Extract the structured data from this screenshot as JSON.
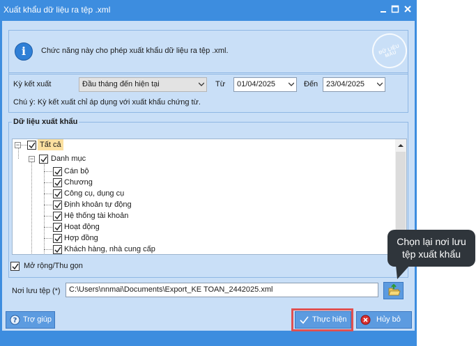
{
  "window": {
    "title": "Xuất khẩu dữ liệu ra tệp .xml",
    "accent_color": "#3d8ddf",
    "controls": [
      "minimize-icon",
      "maximize-icon",
      "close-icon"
    ]
  },
  "info": {
    "text": "Chức năng này cho phép xuất khẩu dữ liệu ra tệp .xml.",
    "icon": "info-icon",
    "stamp_text": "ĐỮ LIỆU MẪU"
  },
  "period": {
    "label": "Kỳ kết xuất",
    "selected": "Đầu tháng đến hiện tại",
    "from_label": "Từ",
    "from_value": "01/04/2025",
    "to_label": "Đến",
    "to_value": "23/04/2025",
    "note": "Chú ý: Kỳ kết xuất chỉ áp dụng với xuất khẩu chứng từ."
  },
  "export": {
    "group_title": "Dữ liệu xuất khẩu",
    "root": "Tất cả",
    "category": "Danh mục",
    "items": [
      "Cán bộ",
      "Chương",
      "Công cụ, dụng cụ",
      "Định khoản tự động",
      "Hệ thống tài khoản",
      "Hoạt động",
      "Hợp đồng",
      "Khách hàng, nhà cung cấp"
    ]
  },
  "expand_collapse_label": "Mở rộng/Thu gọn",
  "save_path": {
    "label": "Nơi lưu tệp (*)",
    "value": "C:\\Users\\nnmai\\Documents\\Export_KE TOAN_2442025.xml"
  },
  "buttons": {
    "help": "Trợ giúp",
    "execute": "Thực hiện",
    "cancel": "Hủy bỏ"
  },
  "tooltip": {
    "line1": "Chọn lại nơi lưu",
    "line2": "tệp xuất khẩu"
  },
  "highlight_color": "#e05050"
}
